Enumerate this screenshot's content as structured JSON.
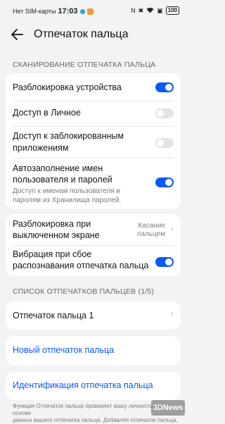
{
  "status_bar": {
    "carrier": "Нет SIM-карты",
    "time": "17:03",
    "battery": "100"
  },
  "header": {
    "title": "Отпечаток пальца"
  },
  "section_scan": {
    "title": "СКАНИРОВАНИЕ ОТПЕЧАТКА ПАЛЬЦА",
    "items": [
      {
        "label": "Разблокировка устройства",
        "toggle": "on"
      },
      {
        "label": "Доступ в Личное",
        "toggle": "off"
      },
      {
        "label_line1": "Доступ к заблокированным",
        "label_line2": "приложениям",
        "toggle": "off"
      },
      {
        "label_line1": "Автозаполнение имен",
        "label_line2": "пользователя и паролей",
        "sub_line1": "Доступ к именам пользователя и",
        "sub_line2": "паролям из Хранилища паролей.",
        "toggle": "on"
      }
    ]
  },
  "section_screen": {
    "items": [
      {
        "label_line1": "Разблокировка при",
        "label_line2": "выключенном экране",
        "value_line1": "Касание",
        "value_line2": "пальцем"
      },
      {
        "label_line1": "Вибрация при сбое",
        "label_line2": "распознавания отпечатка пальца",
        "toggle": "on"
      }
    ]
  },
  "section_list": {
    "title": "СПИСОК ОТПЕЧАТКОВ ПАЛЬЦЕВ (1/5)",
    "fingerprint_1": "Отпечаток пальца 1"
  },
  "actions": {
    "new_fingerprint": "Новый отпечаток пальца",
    "identify_fingerprint": "Идентификация отпечатка пальца"
  },
  "footer": {
    "line1": "Функция Отпечаток пальца проверяет вашу личность на основе",
    "line2": "данных вашего отпечатка пальца. Добавляя отпечаток пальца,"
  },
  "watermark": "3DNews"
}
